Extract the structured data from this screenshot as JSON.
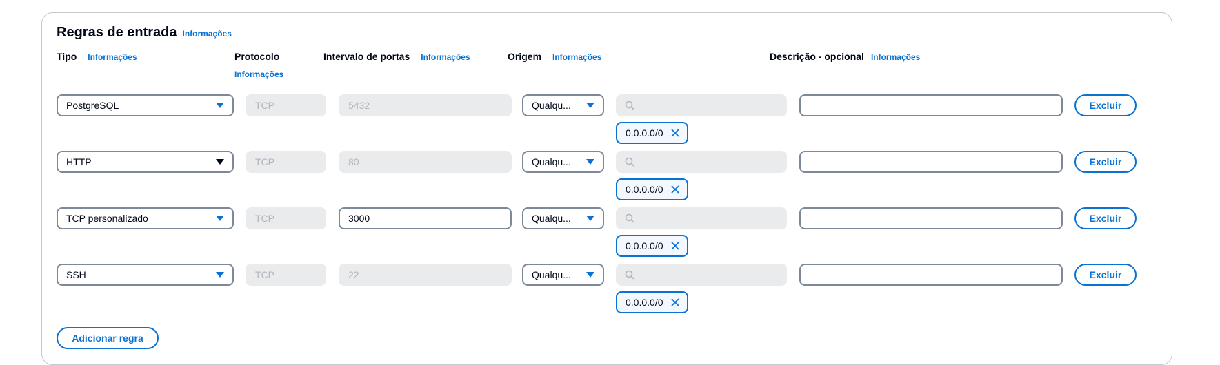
{
  "section": {
    "title": "Regras de entrada",
    "info": "Informações"
  },
  "headers": {
    "tipo": "Tipo",
    "protocolo": "Protocolo",
    "intervalo": "Intervalo de portas",
    "origem": "Origem",
    "descricao": "Descrição - opcional",
    "info": "Informações"
  },
  "rules": [
    {
      "tipo": "PostgreSQL",
      "protocolo": "TCP",
      "portas": "5432",
      "portas_editable": false,
      "origem": "Qualqu...",
      "token": "0.0.0.0/0",
      "descricao": "",
      "excluir": "Excluir"
    },
    {
      "tipo": "HTTP",
      "protocolo": "TCP",
      "portas": "80",
      "portas_editable": false,
      "origem": "Qualqu...",
      "token": "0.0.0.0/0",
      "descricao": "",
      "excluir": "Excluir"
    },
    {
      "tipo": "TCP personalizado",
      "protocolo": "TCP",
      "portas": "3000",
      "portas_editable": true,
      "origem": "Qualqu...",
      "token": "0.0.0.0/0",
      "descricao": "",
      "excluir": "Excluir"
    },
    {
      "tipo": "SSH",
      "protocolo": "TCP",
      "portas": "22",
      "portas_editable": false,
      "origem": "Qualqu...",
      "token": "0.0.0.0/0",
      "descricao": "",
      "excluir": "Excluir"
    }
  ],
  "add_rule_label": "Adicionar regra",
  "colors": {
    "accent": "#0972d3",
    "border": "#7d8998",
    "disabled_bg": "#e9ebed",
    "disabled_text": "#b4b4bb"
  },
  "icons": {
    "caret": "caret-down-icon",
    "search": "search-icon",
    "remove": "close-icon"
  }
}
